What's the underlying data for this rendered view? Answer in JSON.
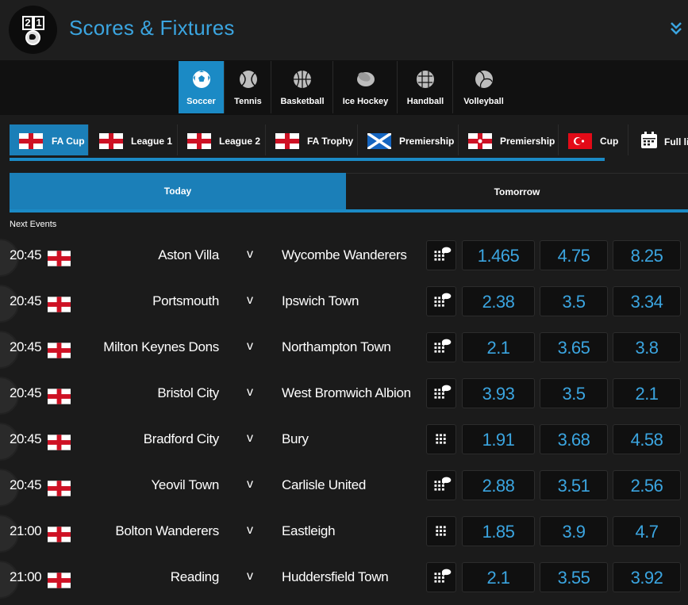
{
  "header": {
    "title": "Scores & Fixtures",
    "logo_digits": [
      "2",
      "1"
    ]
  },
  "sports": [
    {
      "label": "Soccer",
      "icon": "soccer-ball-icon",
      "active": true
    },
    {
      "label": "Tennis",
      "icon": "tennis-ball-icon"
    },
    {
      "label": "Basketball",
      "icon": "basketball-icon"
    },
    {
      "label": "Ice Hockey",
      "icon": "hockey-puck-icon"
    },
    {
      "label": "Handball",
      "icon": "handball-icon"
    },
    {
      "label": "Volleyball",
      "icon": "volleyball-icon"
    }
  ],
  "competitions": [
    {
      "label": "FA Cup",
      "flag": "england",
      "active": true
    },
    {
      "label": "League 1",
      "flag": "england"
    },
    {
      "label": "League 2",
      "flag": "england"
    },
    {
      "label": "FA Trophy",
      "flag": "england"
    },
    {
      "label": "Premiership",
      "flag": "scotland"
    },
    {
      "label": "Premiership",
      "flag": "northern-ireland"
    },
    {
      "label": "Cup",
      "flag": "turkey"
    }
  ],
  "full_list_label": "Full lis",
  "days": {
    "today": "Today",
    "tomorrow": "Tomorrow"
  },
  "next_events_label": "Next Events",
  "events": [
    {
      "time": "20:45",
      "home": "Aston Villa",
      "vs": "v",
      "away": "Wycombe Wanderers",
      "odds": [
        "1.465",
        "4.75",
        "8.25"
      ],
      "comment": true
    },
    {
      "time": "20:45",
      "home": "Portsmouth",
      "vs": "v",
      "away": "Ipswich Town",
      "odds": [
        "2.38",
        "3.5",
        "3.34"
      ],
      "comment": true
    },
    {
      "time": "20:45",
      "home": "Milton Keynes Dons",
      "vs": "v",
      "away": "Northampton Town",
      "odds": [
        "2.1",
        "3.65",
        "3.8"
      ],
      "comment": true
    },
    {
      "time": "20:45",
      "home": "Bristol City",
      "vs": "v",
      "away": "West Bromwich Albion",
      "odds": [
        "3.93",
        "3.5",
        "2.1"
      ],
      "comment": true
    },
    {
      "time": "20:45",
      "home": "Bradford City",
      "vs": "v",
      "away": "Bury",
      "odds": [
        "1.91",
        "3.68",
        "4.58"
      ],
      "comment": false
    },
    {
      "time": "20:45",
      "home": "Yeovil Town",
      "vs": "v",
      "away": "Carlisle United",
      "odds": [
        "2.88",
        "3.51",
        "2.56"
      ],
      "comment": true
    },
    {
      "time": "21:00",
      "home": "Bolton Wanderers",
      "vs": "v",
      "away": "Eastleigh",
      "odds": [
        "1.85",
        "3.9",
        "4.7"
      ],
      "comment": false
    },
    {
      "time": "21:00",
      "home": "Reading",
      "vs": "v",
      "away": "Huddersfield Town",
      "odds": [
        "2.1",
        "3.55",
        "3.92"
      ],
      "comment": true
    }
  ],
  "colors": {
    "accent": "#1b8ac5",
    "odds_text": "#3ba5e0",
    "title": "#3ba5e0"
  }
}
